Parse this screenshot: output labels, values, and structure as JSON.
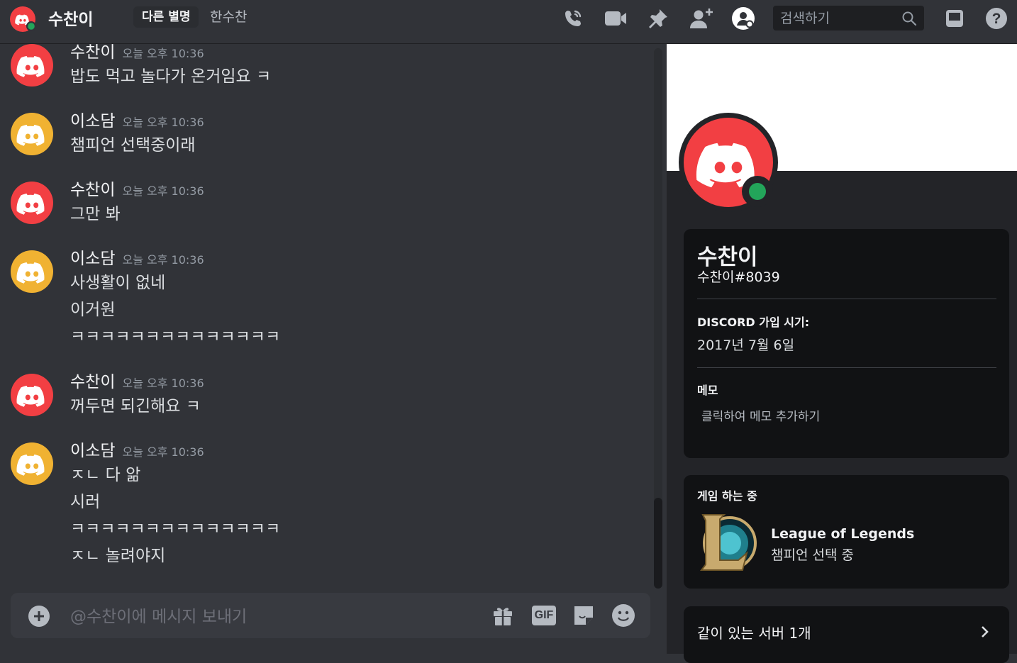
{
  "header": {
    "title": "수찬이",
    "nickname_button": "다른 별명",
    "nickname": "한수찬",
    "search_placeholder": "검색하기"
  },
  "messages": [
    {
      "author": "수찬이",
      "avatar_color": "#f23f43",
      "time": "오늘 오후 10:36",
      "lines": [
        "밥도 먹고 놀다가 온거임요 ㅋ"
      ]
    },
    {
      "author": "이소담",
      "avatar_color": "#f0b232",
      "time": "오늘 오후 10:36",
      "lines": [
        "챔피언 선택중이래"
      ]
    },
    {
      "author": "수찬이",
      "avatar_color": "#f23f43",
      "time": "오늘 오후 10:36",
      "lines": [
        "그만 봐"
      ]
    },
    {
      "author": "이소담",
      "avatar_color": "#f0b232",
      "time": "오늘 오후 10:36",
      "lines": [
        "사생활이 없네",
        "이거원",
        "ㅋㅋㅋㅋㅋㅋㅋㅋㅋㅋㅋㅋㅋㅋ"
      ]
    },
    {
      "author": "수찬이",
      "avatar_color": "#f23f43",
      "time": "오늘 오후 10:36",
      "lines": [
        "꺼두면 되긴해요 ㅋ"
      ]
    },
    {
      "author": "이소담",
      "avatar_color": "#f0b232",
      "time": "오늘 오후 10:36",
      "lines": [
        "ㅈㄴ 다 앎",
        "시러",
        "ㅋㅋㅋㅋㅋㅋㅋㅋㅋㅋㅋㅋㅋㅋ",
        "ㅈㄴ 놀려야지"
      ]
    }
  ],
  "composer": {
    "placeholder": "@수찬이에 메시지 보내기",
    "gif_label": "GIF"
  },
  "profile": {
    "display_name": "수찬이",
    "username": "수찬이#8039",
    "joined_heading": "DISCORD 가입 시기:",
    "joined_date": "2017년 7월 6일",
    "note_heading": "메모",
    "note_placeholder": "클릭하여 메모 추가하기",
    "activity_heading": "게임 하는 중",
    "game_name": "League of Legends",
    "game_state": "챔피언 선택 중",
    "mutual_servers": "같이 있는 서버 1개",
    "status": "online"
  },
  "colors": {
    "brand_red": "#f23f43",
    "brand_yellow": "#f0b232",
    "online": "#23a55a",
    "background": "#313338",
    "panel": "#232428",
    "card": "#111214"
  },
  "icons": [
    "call-icon",
    "video-icon",
    "pin-icon",
    "add-friend-icon",
    "profile-toggle-icon",
    "search-icon",
    "inbox-icon",
    "help-icon",
    "plus-icon",
    "gift-icon",
    "gif-icon",
    "sticker-icon",
    "emoji-icon",
    "chevron-right-icon"
  ]
}
